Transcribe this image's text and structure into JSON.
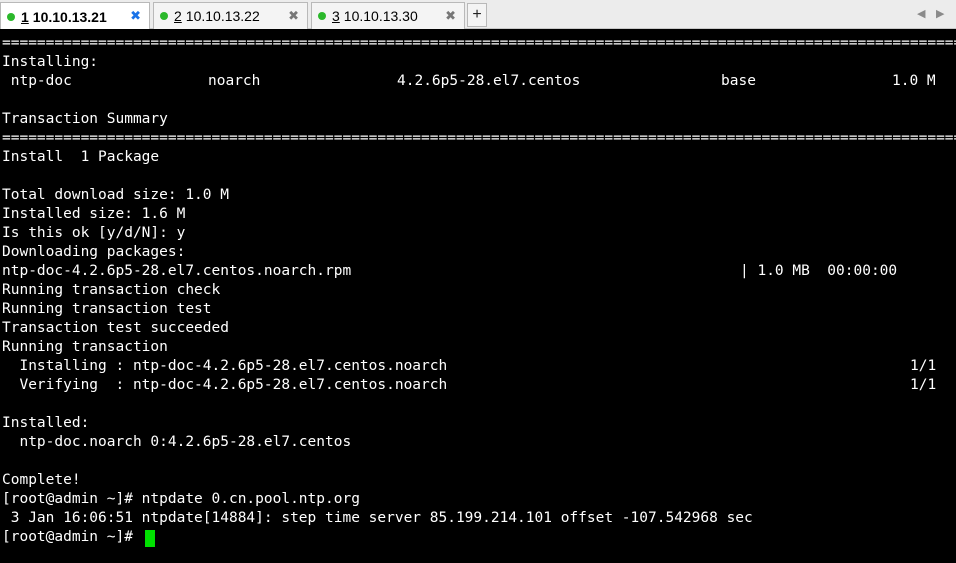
{
  "tabs": [
    {
      "number": "1",
      "host": "10.10.13.21",
      "active": true,
      "dot_color": "#2bb82b",
      "close": "✖"
    },
    {
      "number": "2",
      "host": "10.10.13.22",
      "active": false,
      "dot_color": "#2bb82b",
      "close": "✖"
    },
    {
      "number": "3",
      "host": "10.10.13.30",
      "active": false,
      "dot_color": "#2bb82b",
      "close": "✖"
    }
  ],
  "new_tab_label": "+",
  "scroll_left_icon": "◀",
  "scroll_right_icon": "▶",
  "terminal": {
    "separator": "=======================================================================================================================================",
    "installing_header": "Installing:",
    "pkg_row": {
      "name": " ntp-doc",
      "arch": "noarch",
      "version": "4.2.6p5-28.el7.centos",
      "repo": "base",
      "size": "1.0 M"
    },
    "transaction_summary": "Transaction Summary",
    "install_count": "Install  1 Package",
    "total_download": "Total download size: 1.0 M",
    "installed_size": "Installed size: 1.6 M",
    "prompt_ok": "Is this ok [y/d/N]: y",
    "downloading": "Downloading packages:",
    "download_row": {
      "file": "ntp-doc-4.2.6p5-28.el7.centos.noarch.rpm",
      "stats": "| 1.0 MB  00:00:00"
    },
    "check": "Running transaction check",
    "test": "Running transaction test",
    "test_ok": "Transaction test succeeded",
    "running": "Running transaction",
    "installing_row": {
      "text": "  Installing : ntp-doc-4.2.6p5-28.el7.centos.noarch",
      "progress": "1/1"
    },
    "verifying_row": {
      "text": "  Verifying  : ntp-doc-4.2.6p5-28.el7.centos.noarch",
      "progress": "1/1"
    },
    "installed_header": "Installed:",
    "installed_pkg": "  ntp-doc.noarch 0:4.2.6p5-28.el7.centos",
    "complete": "Complete!",
    "cmd1": "[root@admin ~]# ntpdate 0.cn.pool.ntp.org",
    "ntp_output": " 3 Jan 16:06:51 ntpdate[14884]: step time server 85.199.214.101 offset -107.542968 sec",
    "prompt": "[root@admin ~]# ",
    "cursor_color": "#00e000"
  }
}
